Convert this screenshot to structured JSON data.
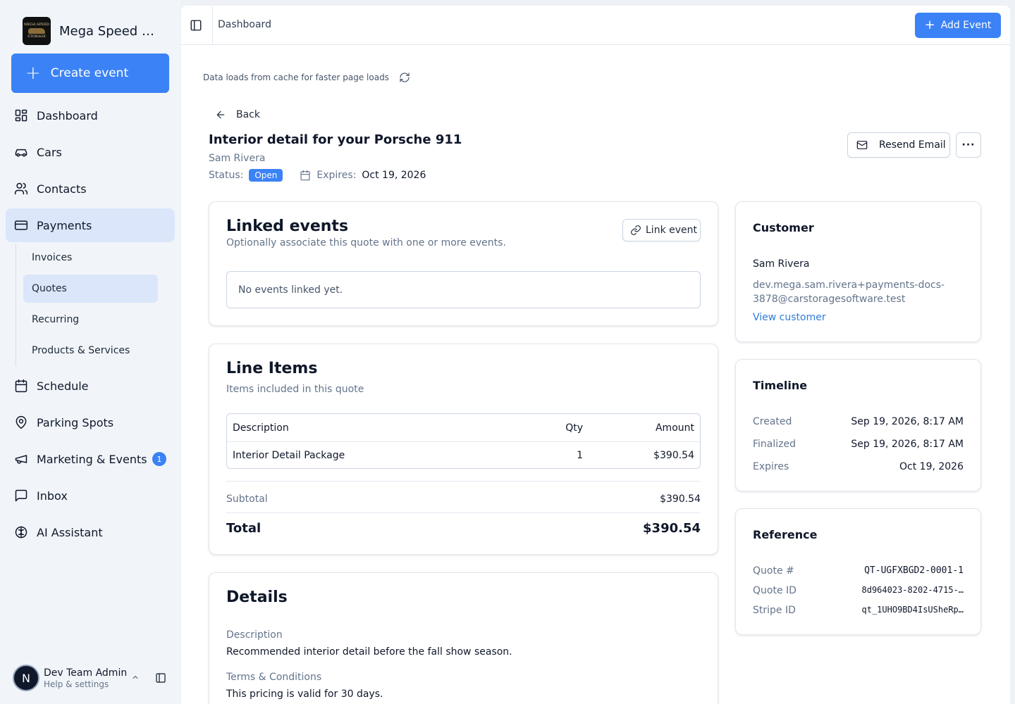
{
  "brand": {
    "name": "Mega Speed Storage",
    "logo_text_top": "MEGA SPEED",
    "logo_text_bottom": "STORAGE"
  },
  "sidebar": {
    "create_label": "Create event",
    "items": [
      {
        "label": "Dashboard",
        "icon": "dashboard-icon"
      },
      {
        "label": "Cars",
        "icon": "car-icon"
      },
      {
        "label": "Contacts",
        "icon": "users-icon"
      },
      {
        "label": "Payments",
        "icon": "credit-card-icon"
      },
      {
        "label": "Schedule",
        "icon": "calendar-icon"
      },
      {
        "label": "Parking Spots",
        "icon": "map-pin-icon"
      },
      {
        "label": "Marketing & Events",
        "icon": "megaphone-icon",
        "badge": "1"
      },
      {
        "label": "Inbox",
        "icon": "message-square-icon"
      },
      {
        "label": "AI Assistant",
        "icon": "brain-icon"
      }
    ],
    "payments_sub": [
      "Invoices",
      "Quotes",
      "Recurring",
      "Products & Services"
    ]
  },
  "user": {
    "initial": "N",
    "name": "Dev Team Admin",
    "subtitle": "Help & settings"
  },
  "topbar": {
    "breadcrumb": "Dashboard",
    "add_event_label": "Add Event"
  },
  "cache_note": "Data loads from cache for faster page loads",
  "quote": {
    "back_label": "Back",
    "title": "Interior detail for your Porsche 911",
    "customer_name": "Sam Rivera",
    "status_label": "Status:",
    "status": "Open",
    "expires_label": "Expires:",
    "expires": "Oct 19, 2026",
    "resend_label": "Resend Email",
    "more_label": "···"
  },
  "linked_events": {
    "title": "Linked events",
    "subtitle": "Optionally associate this quote with one or more events.",
    "link_button": "Link event",
    "empty": "No events linked yet."
  },
  "line_items": {
    "title": "Line Items",
    "subtitle": "Items included in this quote",
    "columns": [
      "Description",
      "Qty",
      "Amount"
    ],
    "rows": [
      {
        "description": "Interior Detail Package",
        "qty": "1",
        "amount": "$390.54"
      }
    ],
    "subtotal_label": "Subtotal",
    "subtotal": "$390.54",
    "total_label": "Total",
    "total": "$390.54"
  },
  "details": {
    "title": "Details",
    "description_label": "Description",
    "description": "Recommended interior detail before the fall show season.",
    "terms_label": "Terms & Conditions",
    "terms": "This pricing is valid for 30 days."
  },
  "customer_card": {
    "title": "Customer",
    "name": "Sam Rivera",
    "email_line1": "dev.mega.sam.rivera+payments-docs-",
    "email_line2": "3878@carstoragesoftware.test",
    "view_link": "View customer"
  },
  "timeline": {
    "title": "Timeline",
    "rows": [
      {
        "label": "Created",
        "value": "Sep 19, 2026, 8:17 AM"
      },
      {
        "label": "Finalized",
        "value": "Sep 19, 2026, 8:17 AM"
      },
      {
        "label": "Expires",
        "value": "Oct 19, 2026"
      }
    ]
  },
  "reference": {
    "title": "Reference",
    "rows": [
      {
        "label": "Quote #",
        "value": "QT-UGFXBGD2-0001-1"
      },
      {
        "label": "Quote ID",
        "value": "8d964023-8202-4715-…"
      },
      {
        "label": "Stripe ID",
        "value": "qt_1UHO9BD4IsUSheRp…"
      }
    ]
  },
  "colors": {
    "accent": "#3b82f6",
    "active_nav": "#dbe6fb",
    "sidebar_bg": "#f1f5f9"
  }
}
